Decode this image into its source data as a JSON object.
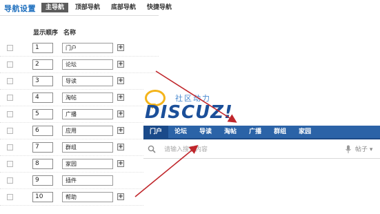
{
  "header": {
    "title": "导航设置",
    "tabs": [
      {
        "label": "主导航",
        "active": true
      },
      {
        "label": "顶部导航",
        "active": false
      },
      {
        "label": "底部导航",
        "active": false
      },
      {
        "label": "快捷导航",
        "active": false
      }
    ]
  },
  "table": {
    "columns": {
      "order": "显示顺序",
      "name": "名称"
    },
    "rows": [
      {
        "order": "1",
        "name": "门户",
        "has_add": true
      },
      {
        "order": "2",
        "name": "论坛",
        "has_add": true
      },
      {
        "order": "3",
        "name": "导读",
        "has_add": true
      },
      {
        "order": "4",
        "name": "淘帖",
        "has_add": true
      },
      {
        "order": "5",
        "name": "广播",
        "has_add": true
      },
      {
        "order": "6",
        "name": "应用",
        "has_add": true
      },
      {
        "order": "7",
        "name": "群组",
        "has_add": true
      },
      {
        "order": "8",
        "name": "家园",
        "has_add": true
      },
      {
        "order": "9",
        "name": "插件",
        "has_add": false
      },
      {
        "order": "10",
        "name": "帮助",
        "has_add": true
      }
    ]
  },
  "preview": {
    "slogan": "社区动力",
    "logo": "DISCUZ!",
    "nav": [
      "门户",
      "论坛",
      "导读",
      "淘帖",
      "广播",
      "群组",
      "家园"
    ],
    "search_placeholder": "请输入搜索内容",
    "search_type": "帖子",
    "chevron": "▾"
  },
  "colors": {
    "title_blue": "#1e6fbe",
    "nav_blue": "#2b63a7",
    "arrow_red": "#c0262b",
    "logo_orange": "#f4b41a"
  },
  "icons": {
    "add": "+"
  }
}
